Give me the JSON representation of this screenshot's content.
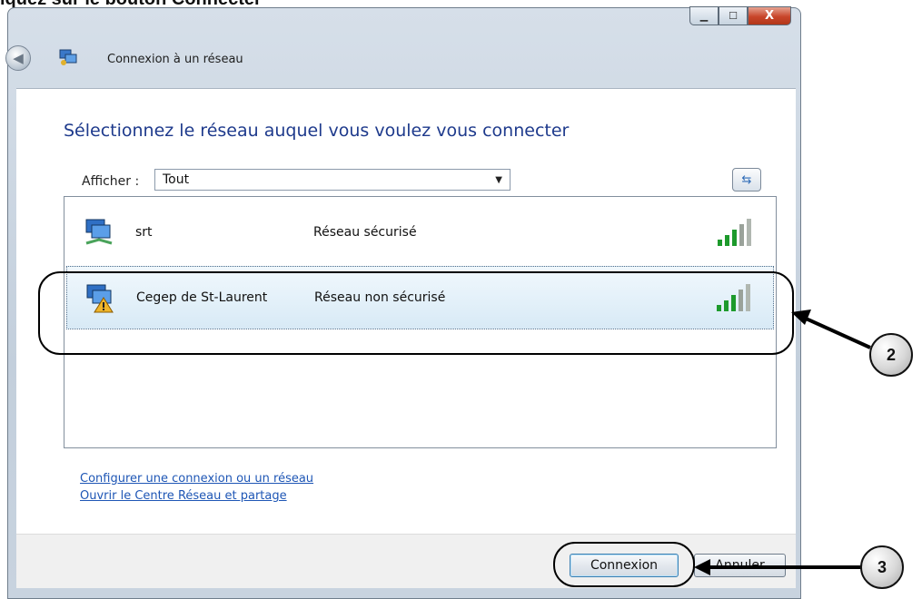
{
  "document": {
    "instruction_fragment": "iquez sur le bouton Connecter"
  },
  "window": {
    "title": "Connexion à un réseau",
    "controls": {
      "minimize_icon": "minimize-icon",
      "maximize_icon": "maximize-icon",
      "close_label": "X"
    }
  },
  "main": {
    "heading": "Sélectionnez le réseau auquel vous voulez vous connecter",
    "filter_label": "Afficher :",
    "filter_value": "Tout",
    "networks": [
      {
        "name": "srt",
        "security": "Réseau sécurisé",
        "icon": "secure-network-icon"
      },
      {
        "name": "Cegep de St-Laurent",
        "security": "Réseau non sécurisé",
        "icon": "unsecured-network-icon"
      }
    ],
    "links": [
      "Configurer une connexion ou un réseau",
      "Ouvrir le Centre Réseau et partage"
    ]
  },
  "footer": {
    "connect_label": "Connexion",
    "cancel_label": "Annuler"
  },
  "annotations": {
    "step_2": "2",
    "step_3": "3"
  },
  "colors": {
    "heading": "#1e3a8c",
    "link": "#1e56b5",
    "selected_row": "#d8eaf6",
    "close_button": "#c8452a"
  }
}
